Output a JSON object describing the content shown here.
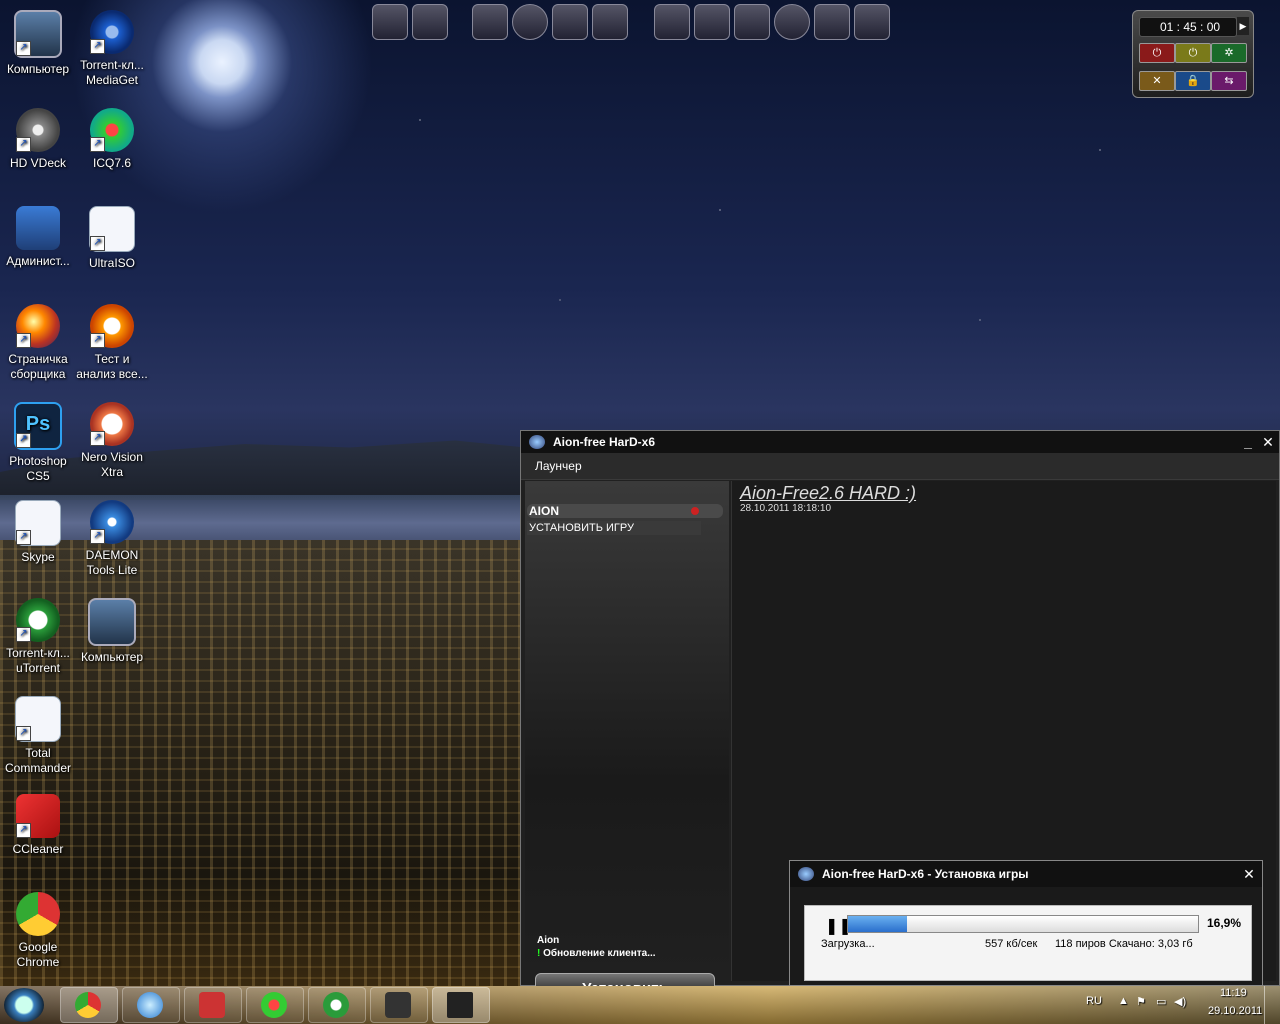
{
  "desktop_icons": [
    {
      "label": "Компьютер"
    },
    {
      "label": "Torrent-кл... MediaGet"
    },
    {
      "label": "HD VDeck"
    },
    {
      "label": "ICQ7.6"
    },
    {
      "label": "Админист..."
    },
    {
      "label": "UltraISO"
    },
    {
      "label": "Страничка сборщика"
    },
    {
      "label": "Тест и анализ все..."
    },
    {
      "label": "Photoshop CS5"
    },
    {
      "label": "Nero Vision Xtra"
    },
    {
      "label": "Skype"
    },
    {
      "label": "DAEMON Tools Lite"
    },
    {
      "label": "Torrent-кл... uTorrent"
    },
    {
      "label": "Компьютер"
    },
    {
      "label": "Total Commander"
    },
    {
      "label": "CCleaner"
    },
    {
      "label": "Google Chrome"
    }
  ],
  "gadget": {
    "time": "01 : 45 : 00",
    "buttons": [
      "⏻",
      "⏻",
      "✲",
      "✕",
      "🔒",
      "⇆"
    ]
  },
  "launcher": {
    "title": "Aion-free HarD-x6",
    "minimize": "_",
    "close": "✕",
    "menu": "Лаунчер",
    "list": [
      {
        "label": "AION"
      },
      {
        "label": "УСТАНОВИТЬ ИГРУ"
      }
    ],
    "news_title": "Aion-Free2.6  HARD :)",
    "news_date": "28.10.2011 18:18:10",
    "status_name": "Aion",
    "status_text": "Обновление клиента...",
    "install_button": "Установить"
  },
  "download": {
    "title": "Aion-free HarD-x6 - Установка игры",
    "close": "✕",
    "pause": "❚❚",
    "progress": 0.169,
    "percent": "16,9%",
    "state": "Загрузка...",
    "speed": "557 кб/сек",
    "peers": "118 пиров Скачано: 3,03 гб"
  },
  "taskbar": {
    "lang": "RU",
    "time": "11:19",
    "date": "29.10.2011"
  }
}
